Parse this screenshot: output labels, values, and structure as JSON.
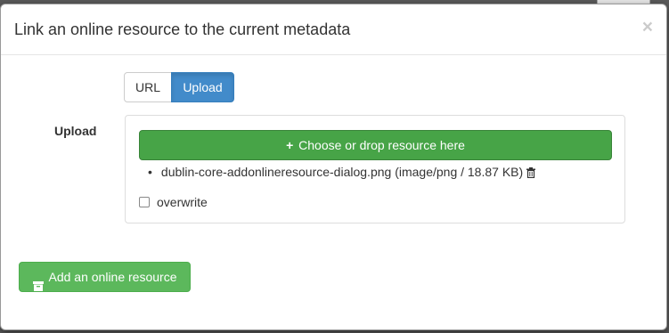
{
  "dialog": {
    "title": "Link an online resource to the current metadata",
    "close_label": "×"
  },
  "mode_toggle": {
    "url_label": "URL",
    "upload_label": "Upload",
    "active": "Upload"
  },
  "upload": {
    "label": "Upload",
    "choose_button": "Choose or drop resource here",
    "choose_icon": "plus-icon",
    "files": [
      {
        "text": "dublin-core-addonlineresource-dialog.png (image/png / 18.87 KB)",
        "icon": "trash-icon"
      }
    ],
    "overwrite_label": "overwrite",
    "overwrite_checked": false
  },
  "footer": {
    "add_button": "Add an online resource",
    "add_icon": "archive-icon"
  },
  "colors": {
    "primary": "#428bca",
    "success": "#47a447",
    "success_light": "#5cb85c"
  }
}
